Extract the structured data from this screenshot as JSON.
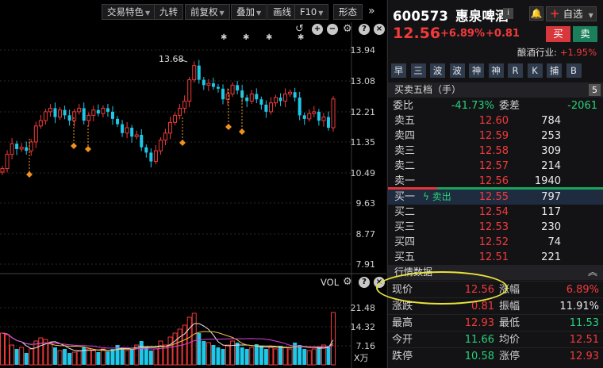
{
  "toolbar": {
    "items": [
      {
        "label": "交易特色",
        "dropdown": true
      },
      {
        "label": "九转",
        "dropdown": false
      },
      {
        "label": "前复权",
        "dropdown": true
      },
      {
        "label": "叠加",
        "dropdown": true
      },
      {
        "label": "画线",
        "dropdown": false
      },
      {
        "label": "F10",
        "dropdown": true
      },
      {
        "label": "形态",
        "dropdown": false
      }
    ],
    "more_icon": "double-chevron-right-icon"
  },
  "price_axis": [
    "13.94",
    "13.08",
    "12.21",
    "11.35",
    "10.49",
    "9.63",
    "8.77",
    "7.91"
  ],
  "high_annotation": "13.68",
  "volume_panel": {
    "label": "VOL",
    "axis": [
      "21.48",
      "14.32",
      "7.16"
    ],
    "unit": "X万"
  },
  "chart_data": {
    "type": "candlestick",
    "price_ticks": [
      13.94,
      13.08,
      12.21,
      11.35,
      10.49,
      9.63,
      8.77,
      7.91
    ],
    "annotation_high": 13.68,
    "volume_ticks": [
      21.48,
      14.32,
      7.16
    ]
  },
  "stock": {
    "code": "600573",
    "name": "惠泉啤酒",
    "info_badge": "i",
    "watch_label": "自选",
    "price": "12.56",
    "pct": "+6.89%",
    "change": "+0.81",
    "buy_label": "买",
    "sell_label": "卖",
    "industry_label": "酿酒行业:",
    "industry_value": "+1.95%"
  },
  "tags": [
    "早",
    "三",
    "波",
    "波",
    "神",
    "神",
    "R",
    "K",
    "捕",
    "B"
  ],
  "order_book": {
    "title": "买卖五档（手）",
    "badge": "5",
    "ratio_label": "委比",
    "ratio_value": "-41.73%",
    "diff_label": "委差",
    "diff_value": "-2061",
    "asks": [
      {
        "label": "卖五",
        "price": "12.60",
        "vol": "784"
      },
      {
        "label": "卖四",
        "price": "12.59",
        "vol": "253"
      },
      {
        "label": "卖三",
        "price": "12.58",
        "vol": "309"
      },
      {
        "label": "卖二",
        "price": "12.57",
        "vol": "214"
      },
      {
        "label": "卖一",
        "price": "12.56",
        "vol": "1940"
      }
    ],
    "bids": [
      {
        "label": "买一",
        "tag": "卖出",
        "price": "12.55",
        "vol": "797"
      },
      {
        "label": "买二",
        "price": "12.54",
        "vol": "117"
      },
      {
        "label": "买三",
        "price": "12.53",
        "vol": "230"
      },
      {
        "label": "买四",
        "price": "12.52",
        "vol": "74"
      },
      {
        "label": "买五",
        "price": "12.51",
        "vol": "221"
      }
    ]
  },
  "quote": {
    "title": "行情数据",
    "rows": [
      {
        "l1": "现价",
        "v1": "12.56",
        "c1": "red",
        "l2": "涨幅",
        "v2": "6.89%",
        "c2": "red"
      },
      {
        "l1": "涨跌",
        "v1": "0.81",
        "c1": "red",
        "l2": "振幅",
        "v2": "11.91%",
        "c2": "white"
      },
      {
        "l1": "最高",
        "v1": "12.93",
        "c1": "red",
        "l2": "最低",
        "v2": "11.53",
        "c2": "green"
      },
      {
        "l1": "今开",
        "v1": "11.66",
        "c1": "green",
        "l2": "均价",
        "v2": "12.51",
        "c2": "red"
      },
      {
        "l1": "跌停",
        "v1": "10.58",
        "c1": "green",
        "l2": "涨停",
        "v2": "12.93",
        "c2": "red"
      }
    ]
  }
}
